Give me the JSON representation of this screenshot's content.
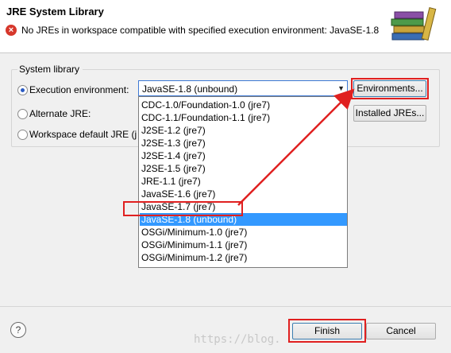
{
  "header": {
    "title": "JRE System Library",
    "error_message": "No JREs in workspace compatible with specified execution environment: JavaSE-1.8"
  },
  "group": {
    "label": "System library",
    "options": [
      {
        "label": "Execution environment:",
        "selected": true
      },
      {
        "label": "Alternate JRE:",
        "selected": false
      },
      {
        "label": "Workspace default JRE (j",
        "selected": false
      }
    ]
  },
  "combo": {
    "value": "JavaSE-1.8 (unbound)",
    "options": [
      "CDC-1.0/Foundation-1.0 (jre7)",
      "CDC-1.1/Foundation-1.1 (jre7)",
      "J2SE-1.2 (jre7)",
      "J2SE-1.3 (jre7)",
      "J2SE-1.4 (jre7)",
      "J2SE-1.5 (jre7)",
      "JRE-1.1 (jre7)",
      "JavaSE-1.6 (jre7)",
      "JavaSE-1.7 (jre7)",
      "JavaSE-1.8 (unbound)",
      "OSGi/Minimum-1.0 (jre7)",
      "OSGi/Minimum-1.1 (jre7)",
      "OSGi/Minimum-1.2 (jre7)"
    ],
    "highlighted_index": 9
  },
  "buttons": {
    "environments": "Environments...",
    "installed_jres": "Installed JREs...",
    "finish": "Finish",
    "cancel": "Cancel"
  },
  "help_icon": "?",
  "watermark": "https://blog.",
  "colors": {
    "annotation_red": "#e02020",
    "selection_blue": "#3399ff",
    "error_red": "#d6372b"
  }
}
